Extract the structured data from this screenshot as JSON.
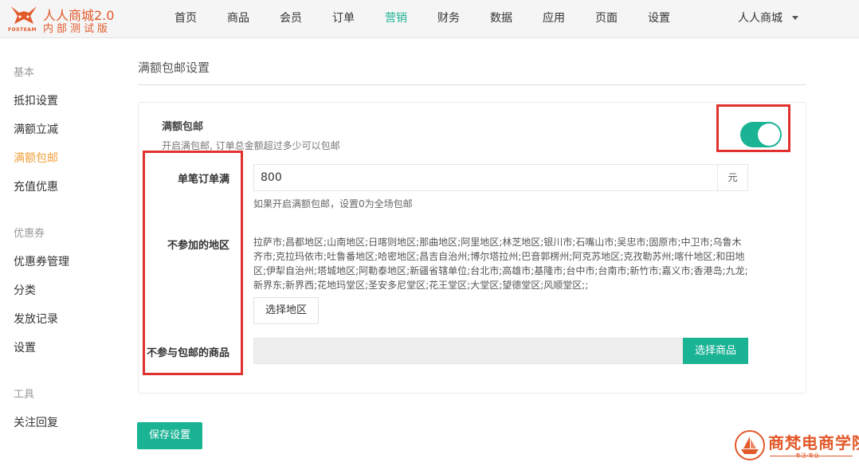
{
  "brand": {
    "title": "人人商城2.0",
    "subtitle": "内部测试版",
    "tag": "FOXTEAM"
  },
  "nav": {
    "items": [
      "首页",
      "商品",
      "会员",
      "订单",
      "营销",
      "财务",
      "数据",
      "应用",
      "页面",
      "设置"
    ],
    "active": "营销",
    "user": "人人商城"
  },
  "sidebar": {
    "group1": "基本",
    "item1": "抵扣设置",
    "item2": "满额立减",
    "item3": "满额包邮",
    "item4": "充值优惠",
    "group2": "优惠券",
    "item5": "优惠券管理",
    "item6": "分类",
    "item7": "发放记录",
    "item8": "设置",
    "group3": "工具",
    "item9": "关注回复"
  },
  "page": {
    "title": "满额包邮设置"
  },
  "form": {
    "section_title": "满额包邮",
    "section_desc": "开启满包邮, 订单总金额超过多少可以包邮",
    "toggle_on": true,
    "min_order_label": "单笔订单满",
    "min_order_value": "800",
    "unit": "元",
    "min_order_help": "如果开启满额包邮，设置0为全场包邮",
    "exclude_regions_label": "不参加的地区",
    "exclude_regions": "拉萨市;昌都地区;山南地区;日喀则地区;那曲地区;阿里地区;林芝地区;银川市;石嘴山市;吴忠市;固原市;中卫市;乌鲁木齐市;克拉玛依市;吐鲁番地区;哈密地区;昌吉自治州;博尔塔拉州;巴音郭楞州;阿克苏地区;克孜勒苏州;喀什地区;和田地区;伊犁自治州;塔城地区;阿勒泰地区;新疆省辖单位;台北市;高雄市;基隆市;台中市;台南市;新竹市;嘉义市;香港岛;九龙;新界东;新界西;花地玛堂区;圣安多尼堂区;花王堂区;大堂区;望德堂区;风顺堂区;;",
    "select_region_button": "选择地区",
    "exclude_goods_label": "不参与包邮的商品",
    "select_goods_button": "选择商品",
    "save_button": "保存设置"
  },
  "watermark": {
    "name": "商梵电商学院",
    "tagline": "专注·专业"
  },
  "colors": {
    "accent": "#1ab394",
    "brand": "#e2592a",
    "sidebar_active": "#f0a13c",
    "highlight_box": "#e0312f"
  }
}
